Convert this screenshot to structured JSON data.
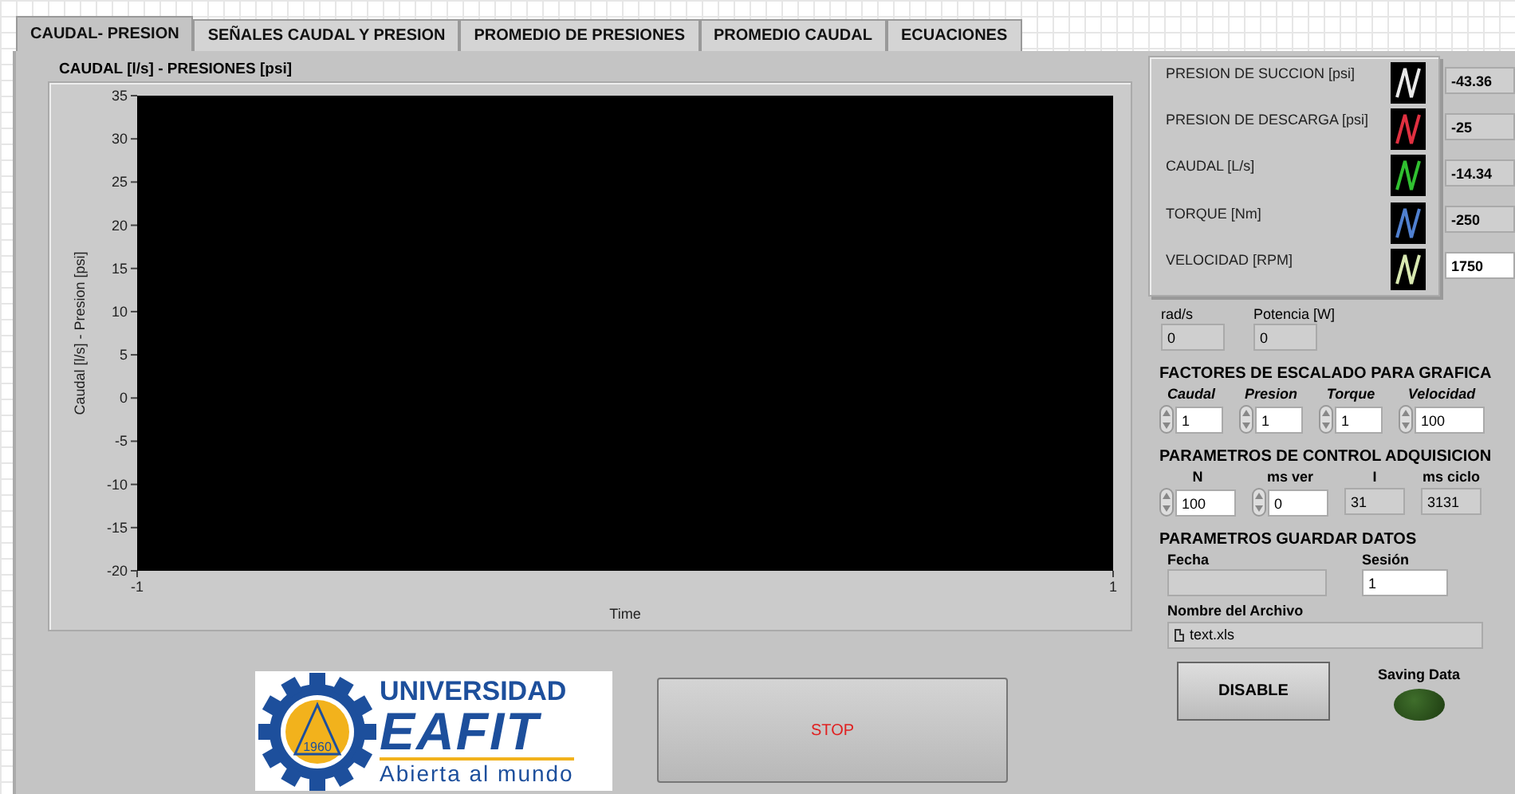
{
  "tabs": [
    {
      "label": "CAUDAL- PRESION",
      "selected": true
    },
    {
      "label": "SEÑALES CAUDAL Y PRESION",
      "selected": false
    },
    {
      "label": "PROMEDIO DE PRESIONES",
      "selected": false
    },
    {
      "label": "PROMEDIO CAUDAL",
      "selected": false
    },
    {
      "label": "ECUACIONES",
      "selected": false
    }
  ],
  "graph": {
    "label": "CAUDAL [l/s] - PRESIONES [psi]",
    "chart_data": {
      "type": "line",
      "xlabel": "Time",
      "ylabel": "Caudal [l/s] - Presion [psi]",
      "xlim": [
        -1,
        1
      ],
      "ylim": [
        -20,
        35
      ],
      "xticks": [
        -1,
        1
      ],
      "yticks": [
        35,
        30,
        25,
        20,
        15,
        10,
        5,
        0,
        -5,
        -10,
        -15,
        -20
      ]
    }
  },
  "legend": [
    {
      "name": "PRESION DE SUCCION [psi]",
      "color": "#e8e8e8",
      "value": "-43.36",
      "kind": "indicator"
    },
    {
      "name": "PRESION  DE DESCARGA [psi]",
      "color": "#e03040",
      "value": "-25",
      "kind": "indicator"
    },
    {
      "name": "CAUDAL [L/s]",
      "color": "#30c030",
      "value": "-14.34",
      "kind": "indicator"
    },
    {
      "name": "TORQUE [Nm]",
      "color": "#5080d0",
      "value": "-250",
      "kind": "indicator"
    },
    {
      "name": "VELOCIDAD [RPM]",
      "color": "#d8e8b0",
      "value": "1750",
      "kind": "control"
    }
  ],
  "readouts": [
    {
      "label": "rad/s",
      "value": "0",
      "kind": "indicator"
    },
    {
      "label": "Potencia [W]",
      "value": "0",
      "kind": "indicator"
    }
  ],
  "scaling": {
    "title": "FACTORES DE ESCALADO PARA GRAFICA",
    "fields": [
      {
        "label": "Caudal",
        "value": "1",
        "kind": "control"
      },
      {
        "label": "Presion",
        "value": "1",
        "kind": "control"
      },
      {
        "label": "Torque",
        "value": "1",
        "kind": "control"
      },
      {
        "label": "Velocidad",
        "value": "100",
        "kind": "control"
      }
    ]
  },
  "acquisition": {
    "title": "PARAMETROS DE CONTROL ADQUISICION",
    "fields": [
      {
        "label": "N",
        "value": "100",
        "kind": "control"
      },
      {
        "label": "ms ver",
        "value": "0",
        "kind": "control"
      },
      {
        "label": "I",
        "value": "31",
        "kind": "indicator"
      },
      {
        "label": "ms ciclo",
        "value": "3131",
        "kind": "indicator"
      }
    ]
  },
  "save": {
    "title": "PARAMETROS GUARDAR DATOS",
    "date_label": "Fecha",
    "session_label": "Sesión",
    "session": "1",
    "file_label": "Nombre del Archivo",
    "file": "text.xls",
    "disable_button": "DISABLE",
    "led_label": "Saving Data",
    "led_on": false
  },
  "logo": {
    "top": "UNIVERSIDAD",
    "name": "EAFIT",
    "year": "1960",
    "slogan": "Abierta al mundo"
  },
  "stop_button": "STOP"
}
